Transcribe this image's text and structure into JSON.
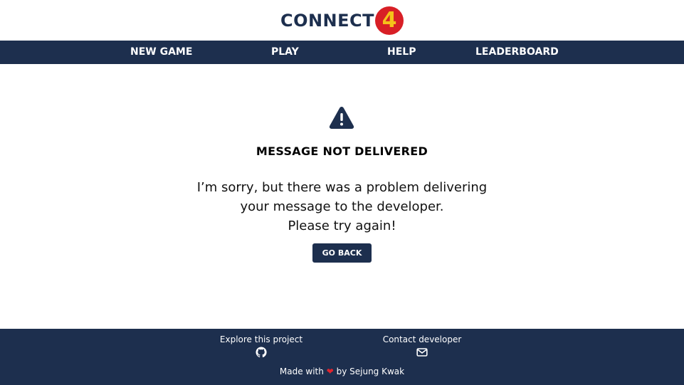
{
  "header": {
    "logo_text": "CONNECT",
    "logo_badge": "4"
  },
  "nav": {
    "items": [
      {
        "label": "NEW GAME"
      },
      {
        "label": "PLAY"
      },
      {
        "label": "HELP"
      },
      {
        "label": "LEADERBOARD"
      }
    ]
  },
  "main": {
    "icon": "warning-triangle-icon",
    "title": "MESSAGE NOT DELIVERED",
    "body_lines": [
      "I’m sorry, but there was a problem delivering",
      "your message to the developer.",
      "Please try again!"
    ],
    "button_label": "GO BACK"
  },
  "footer": {
    "explore_label": "Explore this project",
    "explore_icon": "github-icon",
    "contact_label": "Contact developer",
    "contact_icon": "envelope-icon",
    "made_with_prefix": "Made with",
    "heart": "❤",
    "made_with_suffix": "by Sejung Kwak"
  },
  "colors": {
    "navy": "#1d2f4e",
    "logo_red": "#d81f26",
    "logo_yellow": "#f4c21a",
    "heart_red": "#e0242e"
  }
}
